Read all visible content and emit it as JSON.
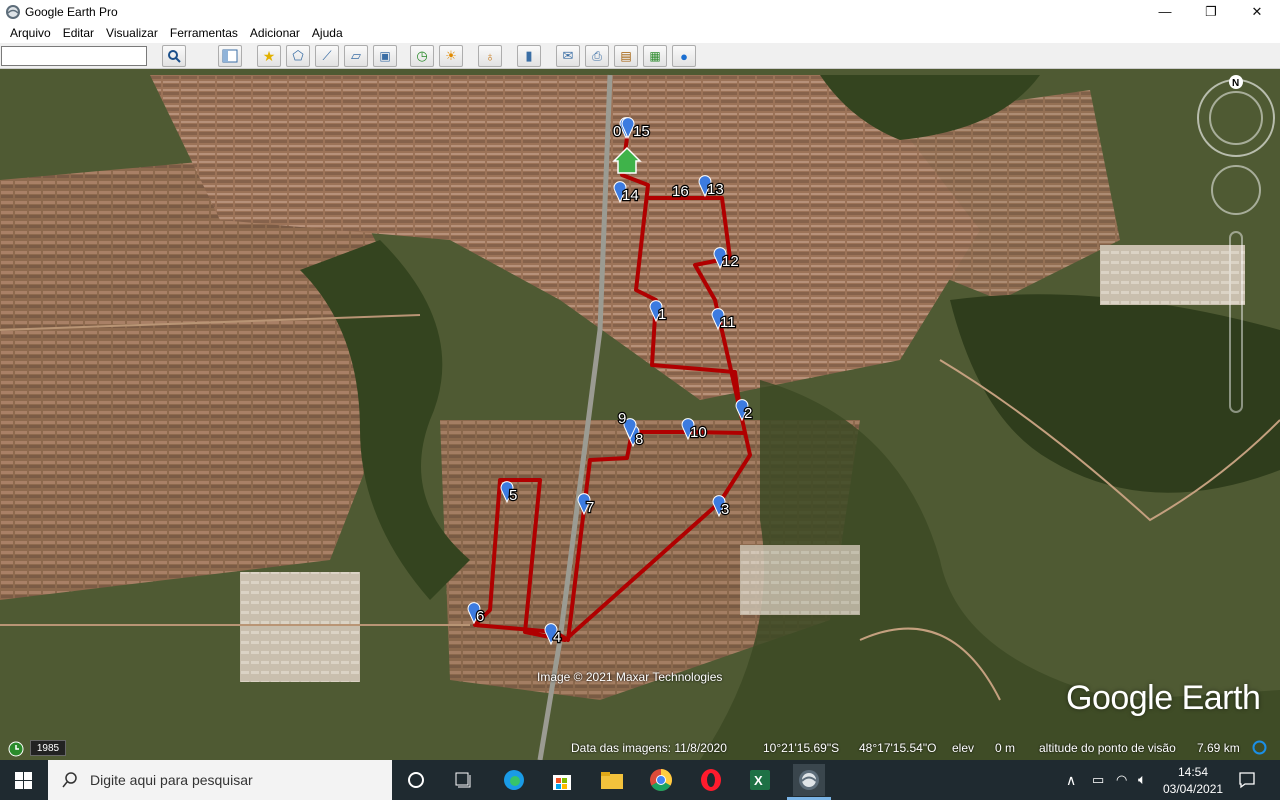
{
  "window": {
    "title": "Google Earth Pro",
    "minimize": "—",
    "maximize": "❐",
    "close": "✕"
  },
  "menu": [
    "Arquivo",
    "Editar",
    "Visualizar",
    "Ferramentas",
    "Adicionar",
    "Ajuda"
  ],
  "toolbar": {
    "search_value": "",
    "icons": [
      "search-icon",
      "sidebar-icon",
      "placemark-icon",
      "polygon-icon",
      "path-icon",
      "overlay-icon",
      "record-tour-icon",
      "historical-imagery-icon",
      "sunlight-icon",
      "planets-icon",
      "ruler-icon",
      "email-icon",
      "print-icon",
      "save-image-icon",
      "map-view-icon",
      "earth-gallery-icon"
    ]
  },
  "map": {
    "credit": "Image © 2021 Maxar Technologies",
    "logo": "Google Earth",
    "year_badge": "1985",
    "compass_north": "N",
    "route_color": "#b00000",
    "placemarks": [
      "0",
      "1",
      "2",
      "3",
      "4",
      "5",
      "6",
      "7",
      "8",
      "9",
      "10",
      "11",
      "12",
      "13",
      "14",
      "15",
      "16"
    ]
  },
  "status": {
    "imagery_date": "Data das imagens: 11/8/2020",
    "lat": "10°21'15.69\"S",
    "lon": "48°17'15.54\"O",
    "elev_label": "elev",
    "elev_value": "0 m",
    "eye_alt_label": "altitude do ponto de visão",
    "eye_alt_value": "7.69 km"
  },
  "taskbar": {
    "search_placeholder": "Digite aqui para pesquisar",
    "time": "14:54",
    "date": "03/04/2021",
    "apps": [
      "cortana-icon",
      "task-view-icon",
      "edge-icon",
      "store-icon",
      "file-explorer-icon",
      "chrome-icon",
      "opera-icon",
      "excel-icon",
      "google-earth-icon"
    ]
  }
}
